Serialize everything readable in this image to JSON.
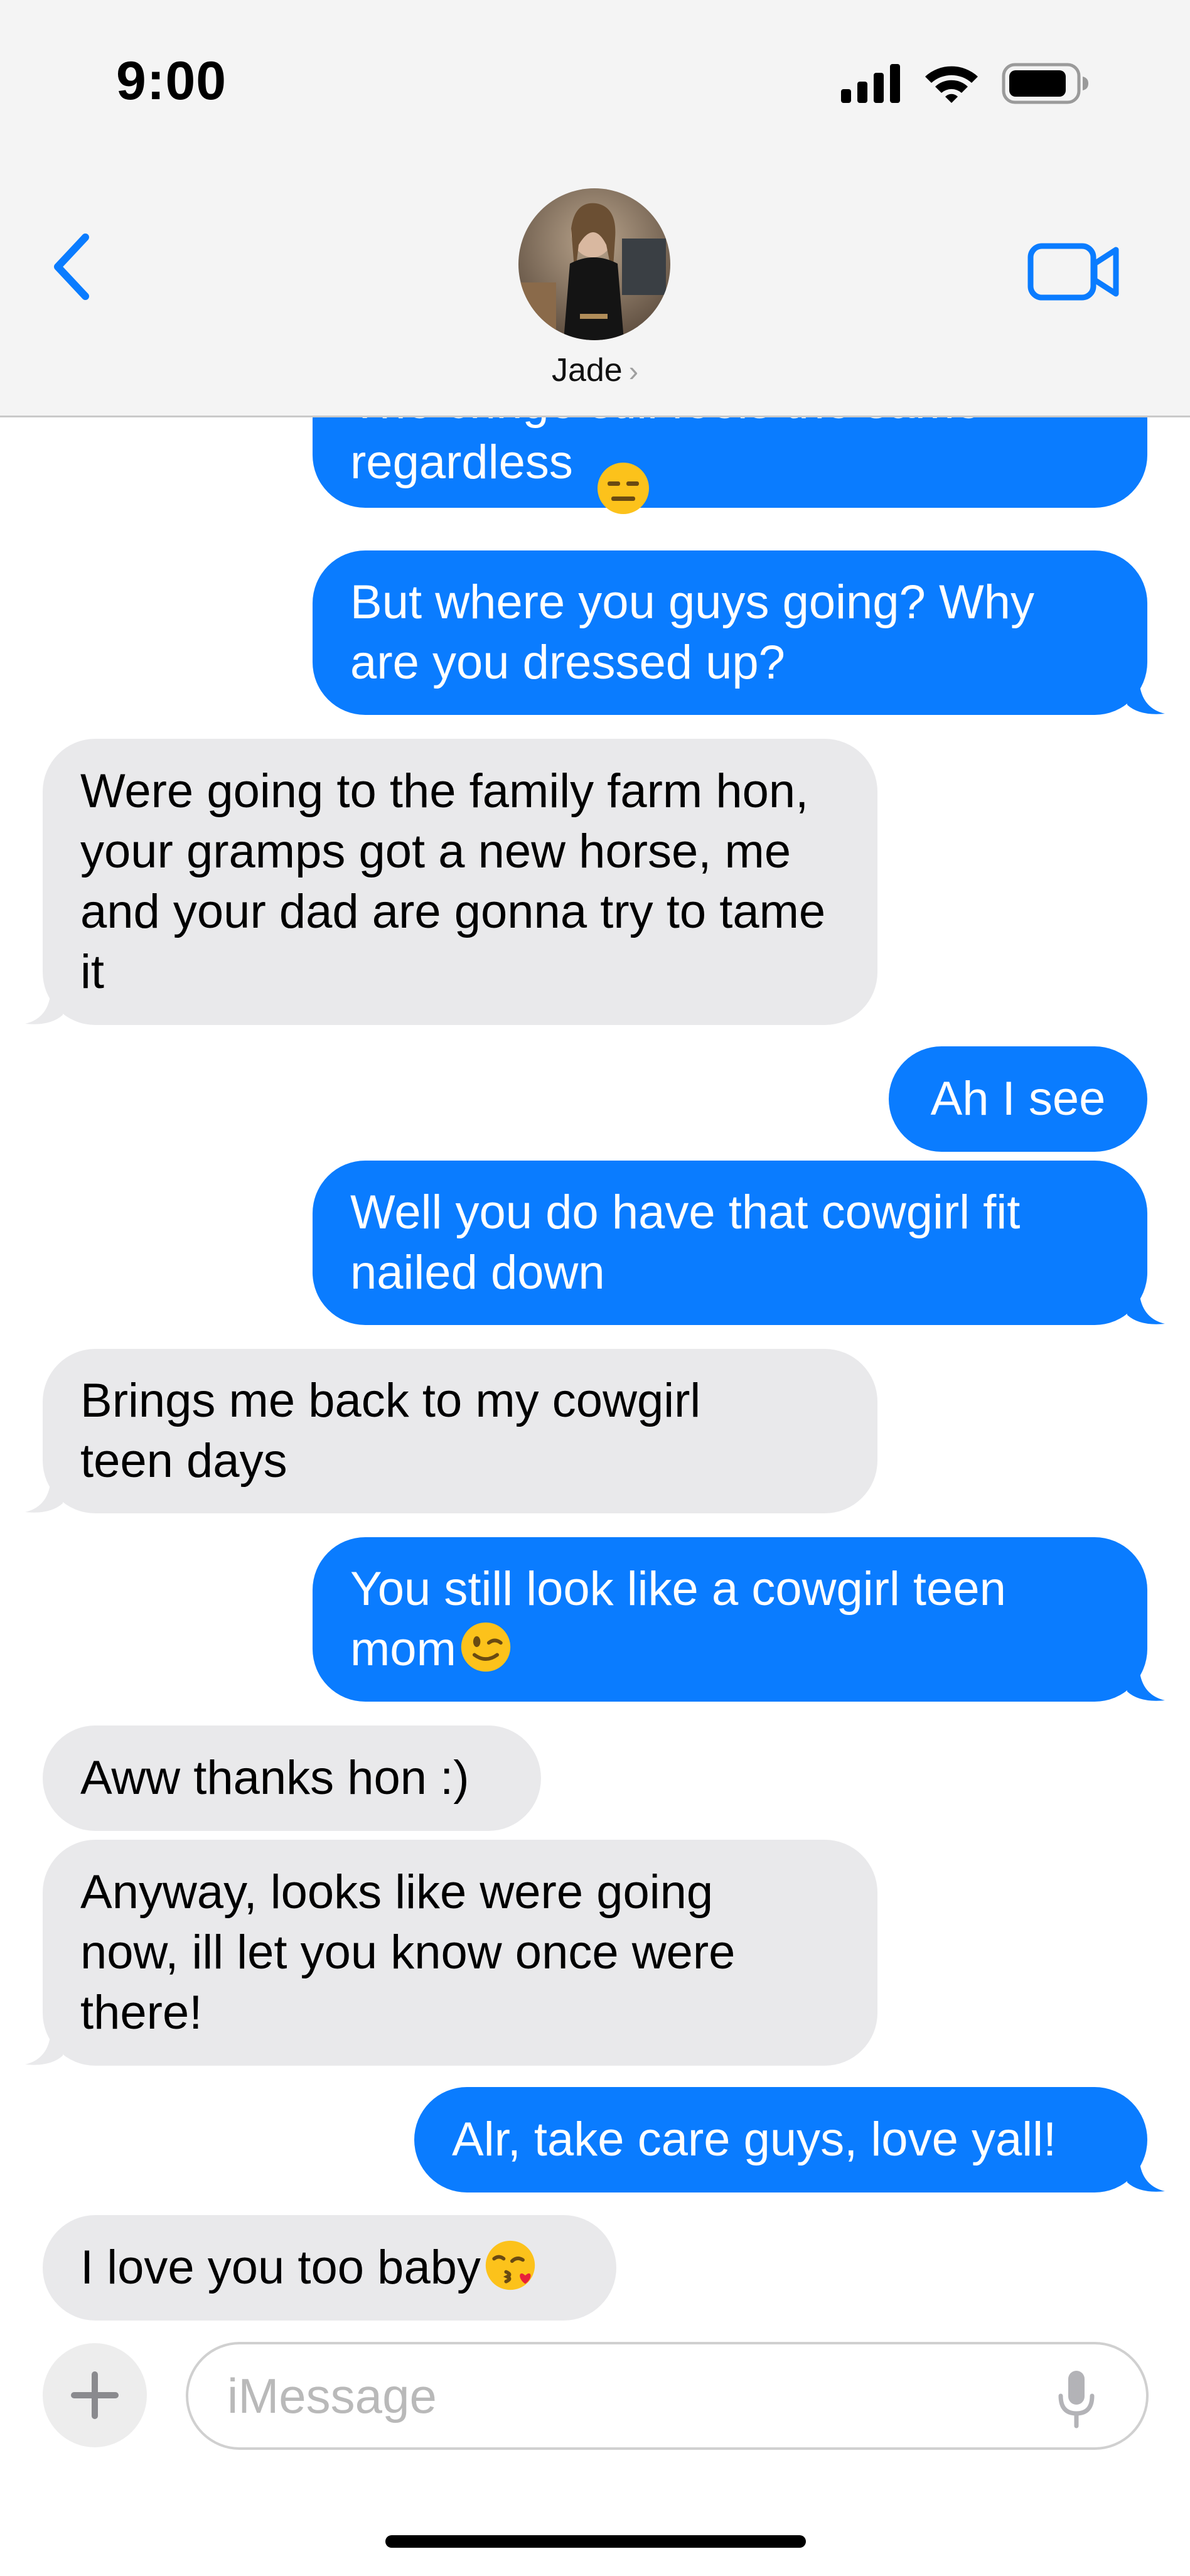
{
  "status_bar": {
    "time": "9:00",
    "icons": [
      "cellular-signal-icon",
      "wifi-icon",
      "battery-icon"
    ]
  },
  "header": {
    "contact_name": "Jade",
    "contact_chevron": "›",
    "back_icon": "chevron-left-icon",
    "video_icon": "video-camera-icon"
  },
  "colors": {
    "accent": "#0a7cff",
    "outgoing_bubble": "#0a7cff",
    "incoming_bubble": "#e9e9eb",
    "header_bg": "#f4f4f4"
  },
  "messages": [
    {
      "direction": "outgoing",
      "text": "The cringe still feels the same regardless",
      "emoji": "expressionless-face",
      "clipped_top": true
    },
    {
      "direction": "outgoing",
      "text": "But where you guys going? Why are you dressed up?",
      "tail": true
    },
    {
      "direction": "incoming",
      "text": "Were going to the family farm hon, your gramps got a new horse, me and your dad are gonna try to tame it",
      "tail": true
    },
    {
      "direction": "outgoing",
      "text": "Ah I see"
    },
    {
      "direction": "outgoing",
      "text": "Well you do have that cowgirl fit nailed down",
      "tail": true
    },
    {
      "direction": "incoming",
      "text": "Brings me back to my cowgirl teen days",
      "tail": true
    },
    {
      "direction": "outgoing",
      "text": "You still look like a cowgirl teen mom",
      "emoji": "winking-face",
      "tail": true
    },
    {
      "direction": "incoming",
      "text": "Aww thanks hon :)"
    },
    {
      "direction": "incoming",
      "text": "Anyway, looks like were going now, ill let you know once were there!",
      "tail": true
    },
    {
      "direction": "outgoing",
      "text": "Alr, take care guys, love yall!",
      "tail": true
    },
    {
      "direction": "incoming",
      "text": "I love you too baby",
      "emoji": "face-blowing-kiss"
    }
  ],
  "input": {
    "placeholder": "iMessage",
    "value": "",
    "plus_icon": "plus-icon",
    "mic_icon": "microphone-icon"
  }
}
